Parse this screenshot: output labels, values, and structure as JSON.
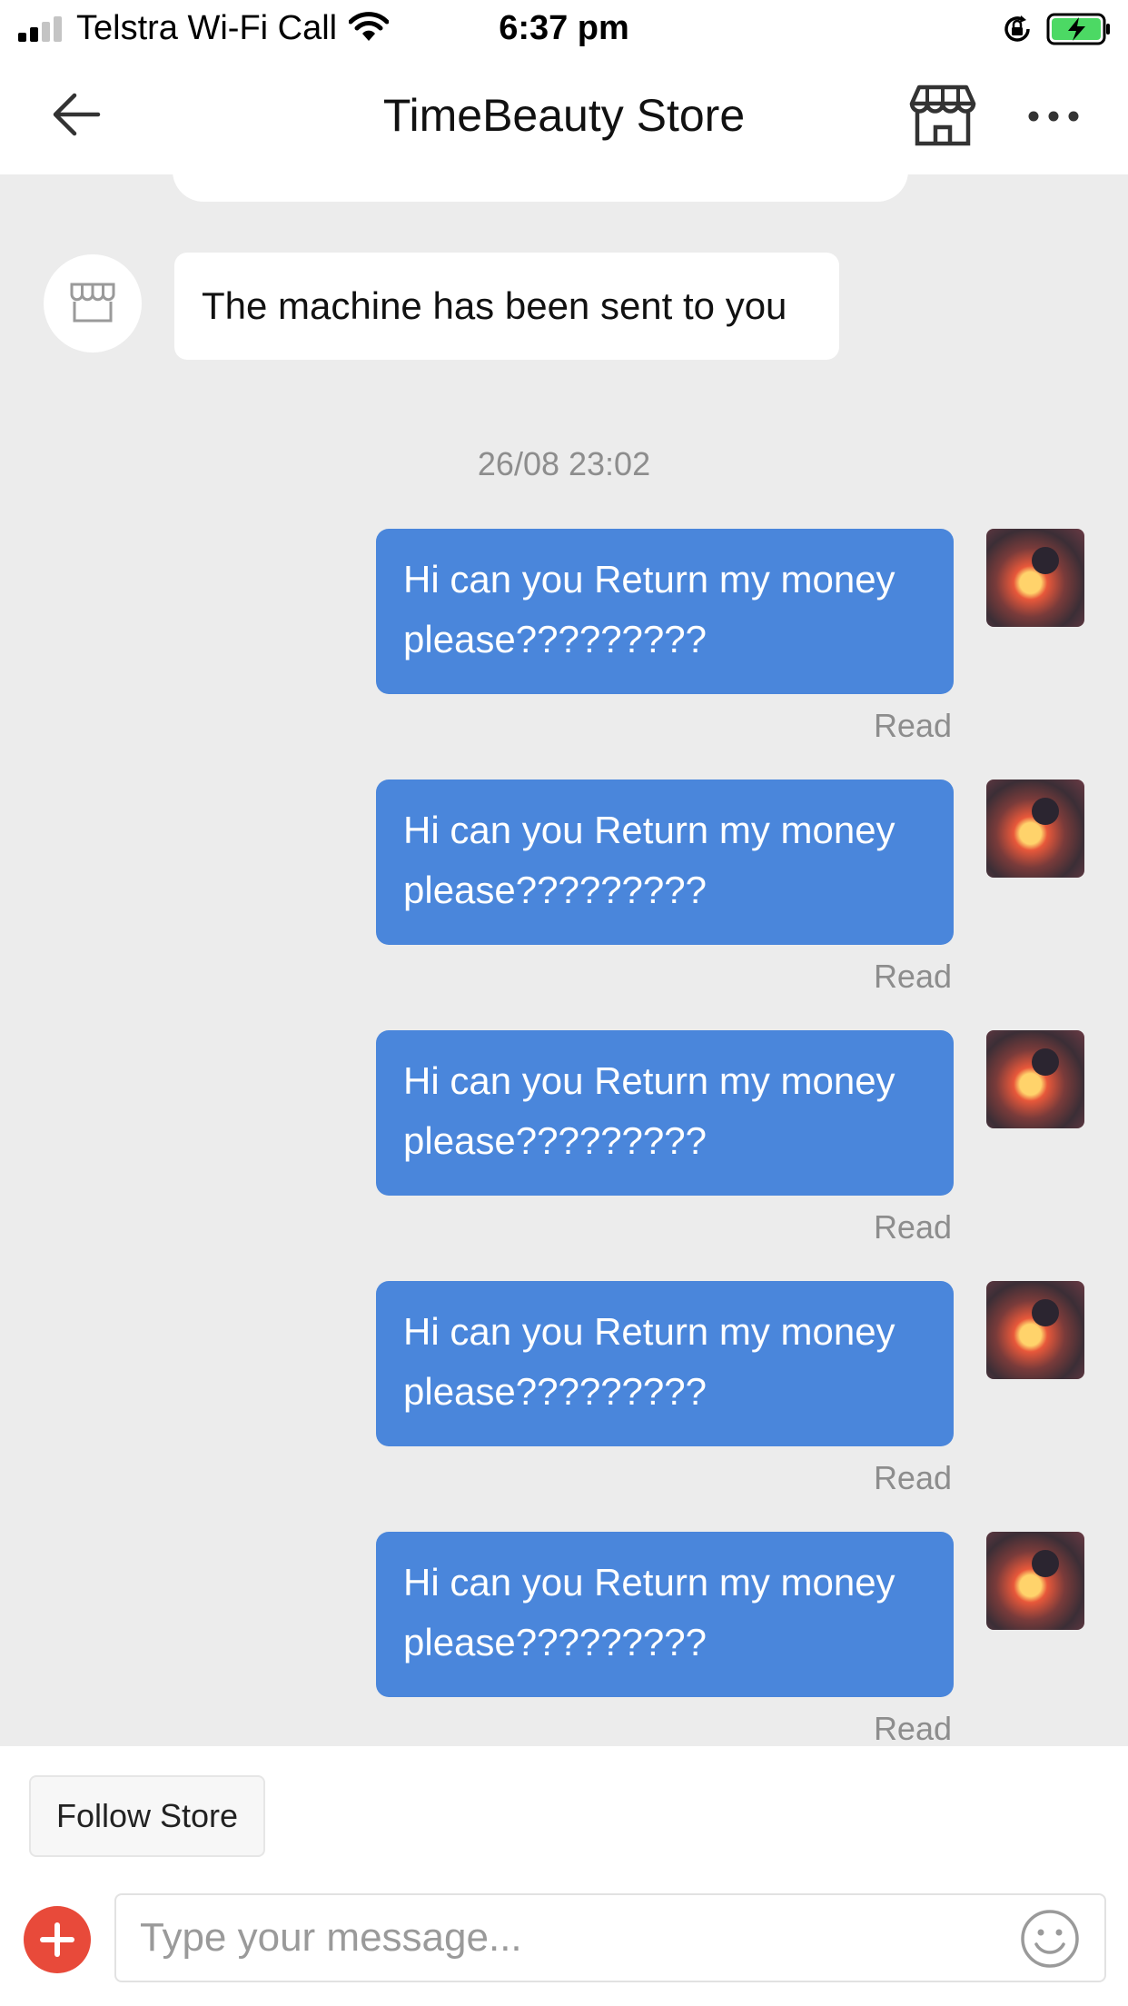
{
  "status_bar": {
    "carrier": "Telstra Wi-Fi Call",
    "time": "6:37 pm",
    "icons": [
      "signal-icon",
      "wifi-icon",
      "rotation-lock-icon",
      "battery-charging-icon"
    ]
  },
  "nav": {
    "title": "TimeBeauty Store",
    "icons": [
      "back-arrow-icon",
      "store-icon",
      "more-icon"
    ]
  },
  "chat": {
    "incoming_message": "The machine has been sent to you",
    "timestamp": "26/08 23:02",
    "outgoing_messages": [
      {
        "text": "Hi can you Return my money please?????????",
        "status": "Read"
      },
      {
        "text": "Hi can you Return my money please?????????",
        "status": "Read"
      },
      {
        "text": "Hi can you Return my money please?????????",
        "status": "Read"
      },
      {
        "text": "Hi can you Return my money please?????????",
        "status": "Read"
      },
      {
        "text": "Hi can you Return my money please?????????",
        "status": "Read"
      }
    ]
  },
  "bottom": {
    "follow_label": "Follow Store",
    "input_placeholder": "Type your message...",
    "icons": [
      "add-icon",
      "emoji-icon"
    ]
  },
  "colors": {
    "outgoing_bubble": "#4a86db",
    "chat_background": "#ececec",
    "add_button": "#e84a3a",
    "battery_green": "#4cd964"
  }
}
